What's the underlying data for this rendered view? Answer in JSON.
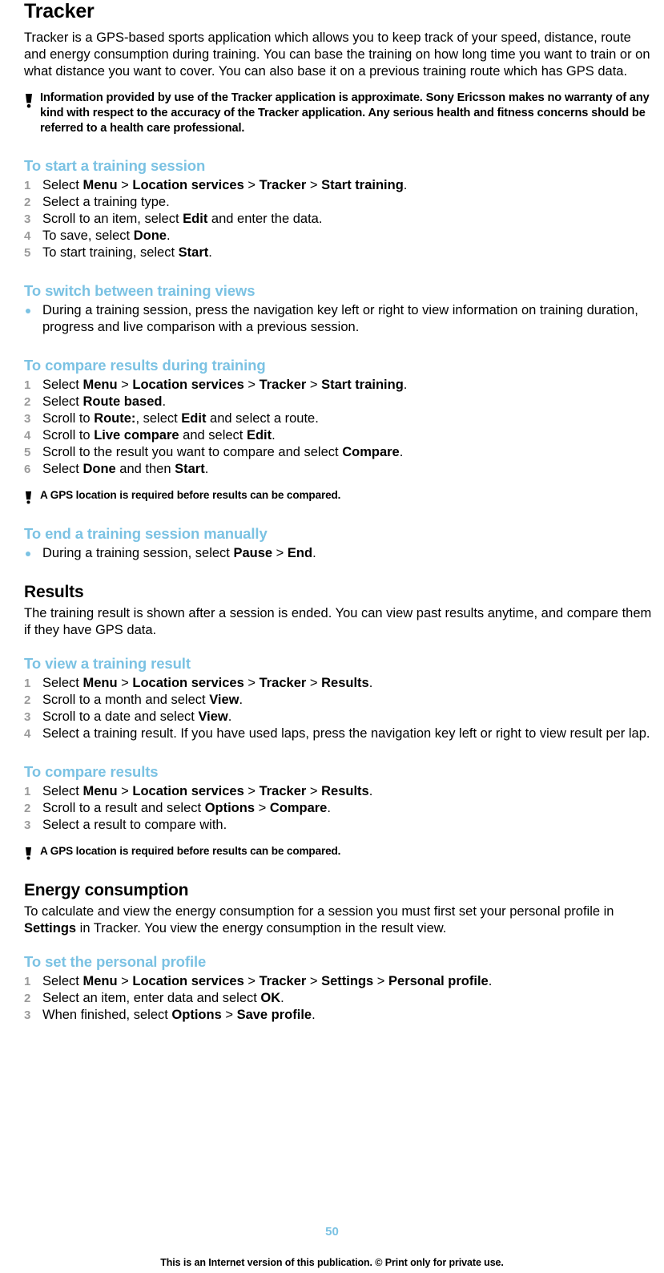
{
  "page": {
    "title": "Tracker",
    "intro": "Tracker is a GPS-based sports application which allows you to keep track of your speed, distance, route and energy consumption during training. You can base the training on how long time you want to train or on what distance you want to cover. You can also base it on a previous training route which has GPS data.",
    "note_main": "Information provided by use of the Tracker application is approximate. Sony Ericsson makes no warranty of any kind with respect to the accuracy of the Tracker application. Any serious health and fitness concerns should be referred to a health care professional.",
    "page_number": "50",
    "footer": "This is an Internet version of this publication. © Print only for private use."
  },
  "sections": {
    "start_session": {
      "heading": "To start a training session",
      "steps": [
        {
          "num": "1",
          "parts": [
            {
              "t": "Select ",
              "b": false
            },
            {
              "t": "Menu",
              "b": true
            },
            {
              "t": " > ",
              "b": false,
              "gt": true
            },
            {
              "t": "Location services",
              "b": true
            },
            {
              "t": " > ",
              "b": false,
              "gt": true
            },
            {
              "t": "Tracker",
              "b": true
            },
            {
              "t": " > ",
              "b": false,
              "gt": true
            },
            {
              "t": "Start training",
              "b": true
            },
            {
              "t": ".",
              "b": false
            }
          ]
        },
        {
          "num": "2",
          "parts": [
            {
              "t": "Select a training type.",
              "b": false
            }
          ]
        },
        {
          "num": "3",
          "parts": [
            {
              "t": "Scroll to an item, select ",
              "b": false
            },
            {
              "t": "Edit",
              "b": true
            },
            {
              "t": " and enter the data.",
              "b": false
            }
          ]
        },
        {
          "num": "4",
          "parts": [
            {
              "t": "To save, select ",
              "b": false
            },
            {
              "t": "Done",
              "b": true
            },
            {
              "t": ".",
              "b": false
            }
          ]
        },
        {
          "num": "5",
          "parts": [
            {
              "t": "To start training, select ",
              "b": false
            },
            {
              "t": "Start",
              "b": true
            },
            {
              "t": ".",
              "b": false
            }
          ]
        }
      ]
    },
    "switch_views": {
      "heading": "To switch between training views",
      "bullets": [
        {
          "parts": [
            {
              "t": "During a training session, press the navigation key left or right to view information on training duration, progress and live comparison with a previous session.",
              "b": false
            }
          ]
        }
      ]
    },
    "compare_during": {
      "heading": "To compare results during training",
      "steps": [
        {
          "num": "1",
          "parts": [
            {
              "t": "Select ",
              "b": false
            },
            {
              "t": "Menu",
              "b": true
            },
            {
              "t": " > ",
              "b": false,
              "gt": true
            },
            {
              "t": "Location services",
              "b": true
            },
            {
              "t": " > ",
              "b": false,
              "gt": true
            },
            {
              "t": "Tracker",
              "b": true
            },
            {
              "t": " > ",
              "b": false,
              "gt": true
            },
            {
              "t": "Start training",
              "b": true
            },
            {
              "t": ".",
              "b": false
            }
          ]
        },
        {
          "num": "2",
          "parts": [
            {
              "t": "Select ",
              "b": false
            },
            {
              "t": "Route based",
              "b": true
            },
            {
              "t": ".",
              "b": false
            }
          ]
        },
        {
          "num": "3",
          "parts": [
            {
              "t": "Scroll to ",
              "b": false
            },
            {
              "t": "Route:",
              "b": true
            },
            {
              "t": ", select ",
              "b": false
            },
            {
              "t": "Edit",
              "b": true
            },
            {
              "t": " and select a route.",
              "b": false
            }
          ]
        },
        {
          "num": "4",
          "parts": [
            {
              "t": "Scroll to ",
              "b": false
            },
            {
              "t": "Live compare",
              "b": true
            },
            {
              "t": " and select ",
              "b": false
            },
            {
              "t": "Edit",
              "b": true
            },
            {
              "t": ".",
              "b": false
            }
          ]
        },
        {
          "num": "5",
          "parts": [
            {
              "t": "Scroll to the result you want to compare and select ",
              "b": false
            },
            {
              "t": "Compare",
              "b": true
            },
            {
              "t": ".",
              "b": false
            }
          ]
        },
        {
          "num": "6",
          "parts": [
            {
              "t": "Select ",
              "b": false
            },
            {
              "t": "Done",
              "b": true
            },
            {
              "t": " and then ",
              "b": false
            },
            {
              "t": "Start",
              "b": true
            },
            {
              "t": ".",
              "b": false
            }
          ]
        }
      ],
      "note": "A GPS location is required before results can be compared."
    },
    "end_session": {
      "heading": "To end a training session manually",
      "bullets": [
        {
          "parts": [
            {
              "t": "During a training session, select ",
              "b": false
            },
            {
              "t": "Pause",
              "b": true
            },
            {
              "t": " > ",
              "b": false,
              "gt": true
            },
            {
              "t": "End",
              "b": true
            },
            {
              "t": ".",
              "b": false
            }
          ]
        }
      ]
    },
    "results": {
      "heading": "Results",
      "intro": "The training result is shown after a session is ended. You can view past results anytime, and compare them if they have GPS data."
    },
    "view_result": {
      "heading": "To view a training result",
      "steps": [
        {
          "num": "1",
          "parts": [
            {
              "t": "Select ",
              "b": false
            },
            {
              "t": "Menu",
              "b": true
            },
            {
              "t": " > ",
              "b": false,
              "gt": true
            },
            {
              "t": "Location services",
              "b": true
            },
            {
              "t": " > ",
              "b": false,
              "gt": true
            },
            {
              "t": "Tracker",
              "b": true
            },
            {
              "t": " > ",
              "b": false,
              "gt": true
            },
            {
              "t": "Results",
              "b": true
            },
            {
              "t": ".",
              "b": false
            }
          ]
        },
        {
          "num": "2",
          "parts": [
            {
              "t": "Scroll to a month and select ",
              "b": false
            },
            {
              "t": "View",
              "b": true
            },
            {
              "t": ".",
              "b": false
            }
          ]
        },
        {
          "num": "3",
          "parts": [
            {
              "t": "Scroll to a date and select ",
              "b": false
            },
            {
              "t": "View",
              "b": true
            },
            {
              "t": ".",
              "b": false
            }
          ]
        },
        {
          "num": "4",
          "parts": [
            {
              "t": "Select a training result. If you have used laps, press the navigation key left or right to view result per lap.",
              "b": false
            }
          ]
        }
      ]
    },
    "compare_results": {
      "heading": "To compare results",
      "steps": [
        {
          "num": "1",
          "parts": [
            {
              "t": "Select ",
              "b": false
            },
            {
              "t": "Menu",
              "b": true
            },
            {
              "t": " > ",
              "b": false,
              "gt": true
            },
            {
              "t": "Location services",
              "b": true
            },
            {
              "t": " > ",
              "b": false,
              "gt": true
            },
            {
              "t": "Tracker",
              "b": true
            },
            {
              "t": " > ",
              "b": false,
              "gt": true
            },
            {
              "t": "Results",
              "b": true
            },
            {
              "t": ".",
              "b": false
            }
          ]
        },
        {
          "num": "2",
          "parts": [
            {
              "t": "Scroll to a result and select ",
              "b": false
            },
            {
              "t": "Options",
              "b": true
            },
            {
              "t": " > ",
              "b": false,
              "gt": true
            },
            {
              "t": "Compare",
              "b": true
            },
            {
              "t": ".",
              "b": false
            }
          ]
        },
        {
          "num": "3",
          "parts": [
            {
              "t": "Select a result to compare with.",
              "b": false
            }
          ]
        }
      ],
      "note": "A GPS location is required before results can be compared."
    },
    "energy": {
      "heading": "Energy consumption",
      "intro_parts": [
        {
          "t": "To calculate and view the energy consumption for a session you must first set your personal profile in ",
          "b": false
        },
        {
          "t": "Settings",
          "b": true
        },
        {
          "t": " in Tracker. You view the energy consumption in the result view.",
          "b": false
        }
      ]
    },
    "personal_profile": {
      "heading": "To set the personal profile",
      "steps": [
        {
          "num": "1",
          "parts": [
            {
              "t": "Select ",
              "b": false
            },
            {
              "t": "Menu",
              "b": true
            },
            {
              "t": " > ",
              "b": false,
              "gt": true
            },
            {
              "t": "Location services",
              "b": true
            },
            {
              "t": " > ",
              "b": false,
              "gt": true
            },
            {
              "t": "Tracker",
              "b": true
            },
            {
              "t": " > ",
              "b": false,
              "gt": true
            },
            {
              "t": "Settings",
              "b": true
            },
            {
              "t": " > ",
              "b": false,
              "gt": true
            },
            {
              "t": "Personal profile",
              "b": true
            },
            {
              "t": ".",
              "b": false
            }
          ]
        },
        {
          "num": "2",
          "parts": [
            {
              "t": "Select an item, enter data and select ",
              "b": false
            },
            {
              "t": "OK",
              "b": true
            },
            {
              "t": ".",
              "b": false
            }
          ]
        },
        {
          "num": "3",
          "parts": [
            {
              "t": "When finished, select ",
              "b": false
            },
            {
              "t": "Options",
              "b": true
            },
            {
              "t": " > ",
              "b": false,
              "gt": true
            },
            {
              "t": "Save profile",
              "b": true
            },
            {
              "t": ".",
              "b": false
            }
          ]
        }
      ]
    }
  },
  "icons": {
    "note": "exclamation-note-icon"
  }
}
